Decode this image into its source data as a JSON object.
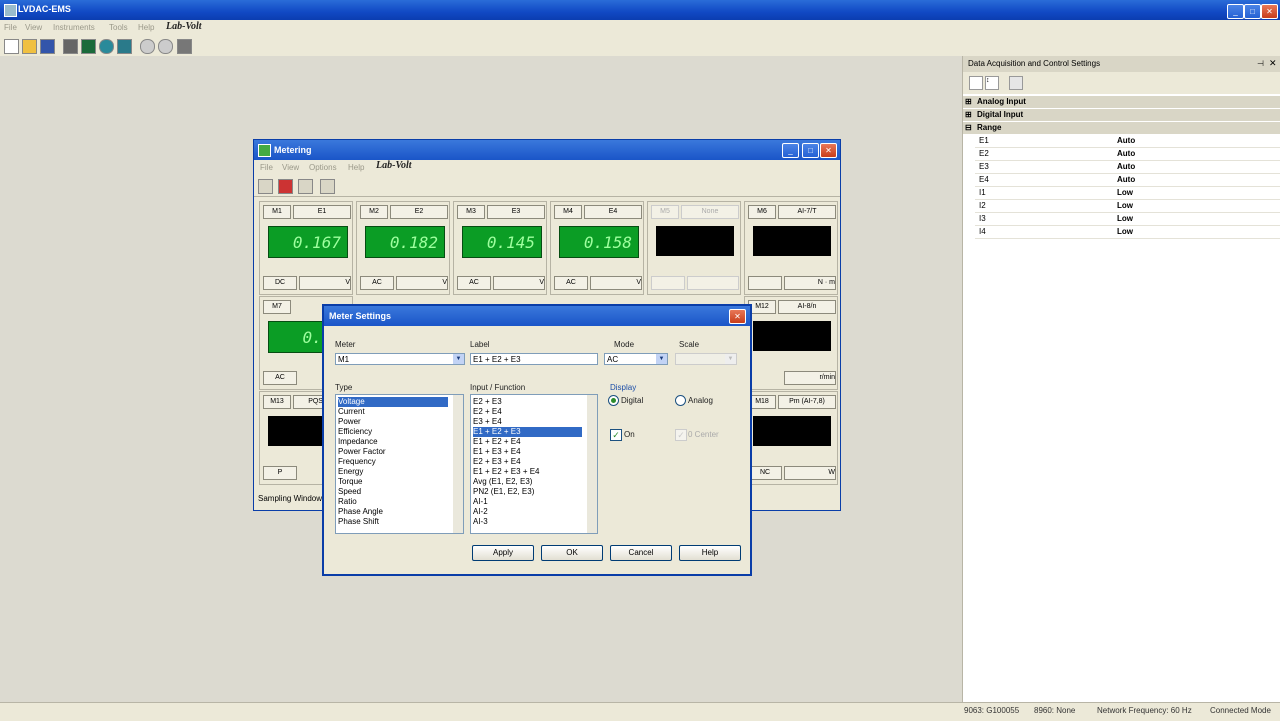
{
  "app": {
    "title": "LVDAC-EMS",
    "menu": [
      "File",
      "View",
      "Instruments",
      "Tools",
      "Help"
    ],
    "logo": "Lab-Volt"
  },
  "status": {
    "s1": "9063: G100055",
    "s2": "8960: None",
    "s3": "Network Frequency: 60 Hz",
    "s4": "Connected Mode"
  },
  "pane": {
    "title": "Data Acquisition and Control Settings",
    "groups": [
      "Analog Input",
      "Digital Input",
      "Range"
    ],
    "range_rows": [
      {
        "k": "E1",
        "v": "Auto"
      },
      {
        "k": "E2",
        "v": "Auto"
      },
      {
        "k": "E3",
        "v": "Auto"
      },
      {
        "k": "E4",
        "v": "Auto"
      },
      {
        "k": "I1",
        "v": "Low"
      },
      {
        "k": "I2",
        "v": "Low"
      },
      {
        "k": "I3",
        "v": "Low"
      },
      {
        "k": "I4",
        "v": "Low"
      }
    ]
  },
  "metering": {
    "title": "Metering",
    "menu": [
      "File",
      "View",
      "Options",
      "Help"
    ],
    "logo": "Lab-Volt",
    "footer": "Sampling Window",
    "row1": [
      {
        "id": "M1",
        "input": "E1",
        "val": "0.167",
        "mode": "DC",
        "unit": "V",
        "on": true
      },
      {
        "id": "M2",
        "input": "E2",
        "val": "0.182",
        "mode": "AC",
        "unit": "V",
        "on": true
      },
      {
        "id": "M3",
        "input": "E3",
        "val": "0.145",
        "mode": "AC",
        "unit": "V",
        "on": true
      },
      {
        "id": "M4",
        "input": "E4",
        "val": "0.158",
        "mode": "AC",
        "unit": "V",
        "on": true
      },
      {
        "id": "M5",
        "input": "None",
        "val": "",
        "mode": "",
        "unit": "",
        "on": false
      },
      {
        "id": "M6",
        "input": "AI-7/T",
        "val": "",
        "mode": "",
        "unit": "N · m",
        "on": false
      }
    ],
    "m7": {
      "id": "M7",
      "val": "0.00",
      "mode": "AC"
    },
    "m12": {
      "id": "M12",
      "input": "AI-8/n",
      "unit": "r/min"
    },
    "m13": {
      "id": "M13",
      "input": "PQS1 (E"
    },
    "m13_mode": "P",
    "m18": {
      "id": "M18",
      "input": "Pm (AI-7,8)",
      "mode": "NC",
      "unit": "W"
    }
  },
  "dialog": {
    "title": "Meter Settings",
    "meter_label": "Meter",
    "meter_value": "M1",
    "label_label": "Label",
    "label_value": "E1 + E2 + E3",
    "mode_label": "Mode",
    "mode_value": "AC",
    "scale_label": "Scale",
    "type_label": "Type",
    "types": [
      "Voltage",
      "Current",
      "Power",
      "Efficiency",
      "Impedance",
      "Power Factor",
      "Frequency",
      "Energy",
      "Torque",
      "Speed",
      "Ratio",
      "Phase Angle",
      "Phase Shift"
    ],
    "input_label": "Input / Function",
    "inputs": [
      "E2 + E3",
      "E2 + E4",
      "E3 + E4",
      "E1 + E2 + E3",
      "E1 + E2 + E4",
      "E1 + E3 + E4",
      "E2 + E3 + E4",
      "E1 + E2 + E3 + E4",
      "Avg (E1, E2, E3)",
      "PN2 (E1, E2, E3)",
      "AI-1",
      "AI-2",
      "AI-3"
    ],
    "display_label": "Display",
    "digital": "Digital",
    "analog": "Analog",
    "on": "On",
    "zero_center": "0 Center",
    "apply": "Apply",
    "ok": "OK",
    "cancel": "Cancel",
    "help": "Help"
  }
}
